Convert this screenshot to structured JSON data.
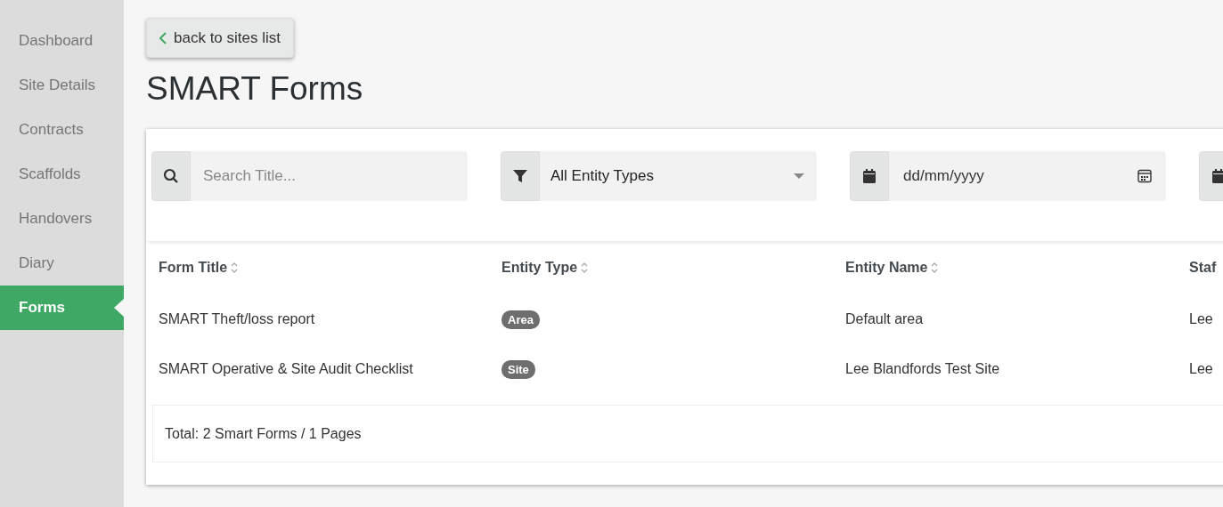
{
  "sidebar": {
    "items": [
      {
        "label": "Dashboard",
        "selected": false
      },
      {
        "label": "Site Details",
        "selected": false
      },
      {
        "label": "Contracts",
        "selected": false
      },
      {
        "label": "Scaffolds",
        "selected": false
      },
      {
        "label": "Handovers",
        "selected": false
      },
      {
        "label": "Diary",
        "selected": false
      },
      {
        "label": "Forms",
        "selected": true
      }
    ]
  },
  "back_button": {
    "label": "back to sites list"
  },
  "title": "SMART Forms",
  "filters": [
    {
      "kind": "search",
      "placeholder": "Search Title..."
    },
    {
      "kind": "select",
      "value": "All Entity Types"
    },
    {
      "kind": "date",
      "placeholder": "dd/mm/yyyy"
    },
    {
      "kind": "date"
    }
  ],
  "table": {
    "columns": [
      "Form Title",
      "Entity Type",
      "Entity Name",
      "Staf"
    ],
    "rows": [
      {
        "form_title": "SMART Theft/loss report",
        "entity_type": "Area",
        "entity_name": "Default area",
        "staff": "Lee"
      },
      {
        "form_title": "SMART Operative & Site Audit Checklist",
        "entity_type": "Site",
        "entity_name": "Lee Blandfords Test Site",
        "staff": "Lee"
      }
    ]
  },
  "footer": "Total: 2 Smart Forms / 1 Pages"
}
